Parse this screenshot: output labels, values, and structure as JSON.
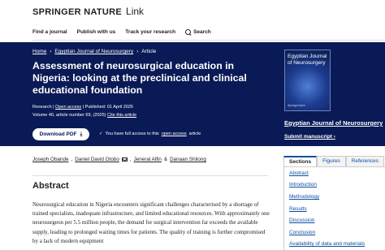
{
  "brand": {
    "name": "SPRINGER NATURE",
    "product": "Link"
  },
  "nav": {
    "find_journal": "Find a journal",
    "publish": "Publish with us",
    "track": "Track your research",
    "search": "Search"
  },
  "breadcrumb": [
    "Home",
    "Egyptian Journal of Neurosurgery",
    "Article"
  ],
  "article": {
    "title": "Assessment of neurosurgical education in Nigeria: looking at the preclinical and clinical educational foundation",
    "type": "Research",
    "access": "Open access",
    "published": "Published: 01 April 2025",
    "volume": "Volume 40, article number 69, (2025)",
    "cite": "Cite this article",
    "download": "Download PDF",
    "access_note_prefix": "You have full access to this",
    "access_note_link": "open access",
    "access_note_suffix": "article"
  },
  "journal": {
    "cover_title": "Egyptian Journal of Neurosurgery",
    "cover_brand": "SpringerOpen",
    "link": "Egyptian Journal of Neurosurgery",
    "submit": "Submit manuscript"
  },
  "authors": [
    "Joseph Obande",
    "Daniel David Otobo",
    "Jeneral Alfin",
    "Danaan Shilong"
  ],
  "author_sep_and": "&",
  "abstract": {
    "heading": "Abstract",
    "body": "Neurosurgical education in Nigeria encounters significant challenges characterised by a shortage of trained specialists, inadequate infrastructure, and limited educational resources. With approximately one neurosurgeon per 5.5 million people, the demand for surgical intervention far exceeds the available supply, leading to prolonged waiting times for patients. The quality of training is further compromised by a lack of modern equipment"
  },
  "panel": {
    "tabs": [
      "Sections",
      "Figures",
      "References"
    ],
    "sections": [
      "Abstract",
      "Introduction",
      "Methodology",
      "Results",
      "Discussion",
      "Conclusion",
      "Availability of data and materials"
    ]
  },
  "colors": {
    "hero": "#0a1a56",
    "link": "#0b4fa1"
  }
}
